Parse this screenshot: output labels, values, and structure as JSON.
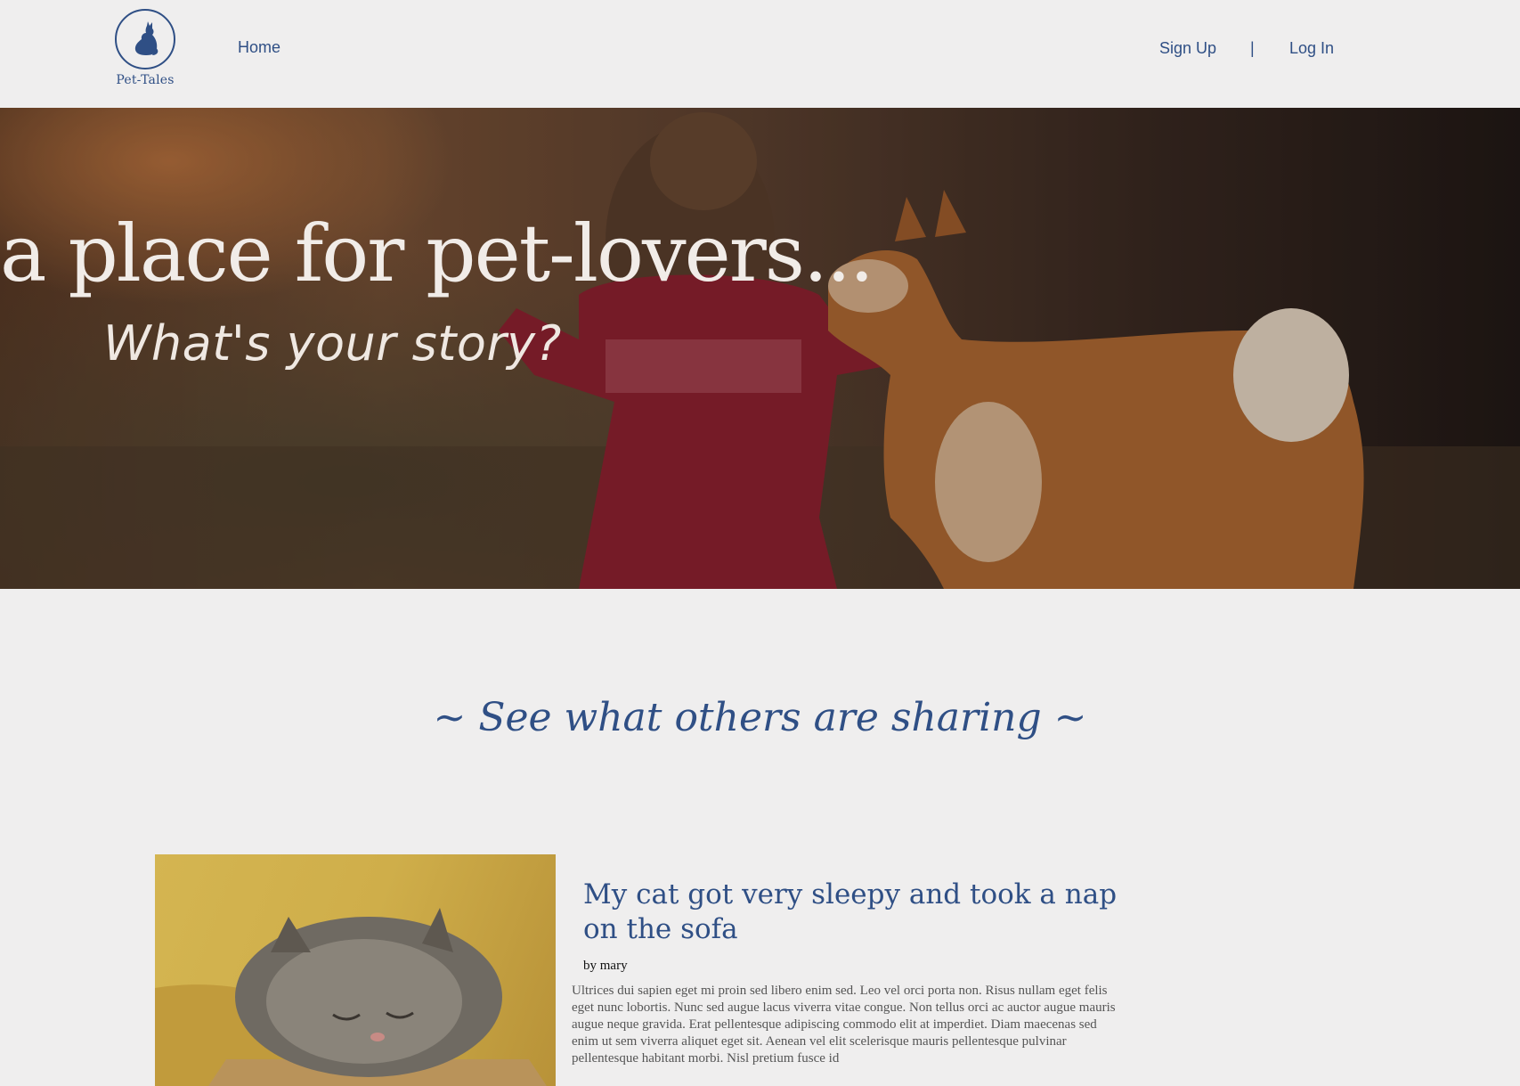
{
  "brand": {
    "name": "Pet-Tales",
    "icon": "cat-silhouette-icon"
  },
  "nav": {
    "home": "Home",
    "sign_up": "Sign Up",
    "separator": "|",
    "log_in": "Log In"
  },
  "hero": {
    "title": "a place for pet-lovers...",
    "subtitle": "What's your story?"
  },
  "section": {
    "title": "~ See what others are sharing ~"
  },
  "posts": [
    {
      "title": "My cat got very sleepy and took a nap on the sofa",
      "author": "by mary",
      "body": "Ultrices dui sapien eget mi proin sed libero enim sed. Leo vel orci porta non. Risus nullam eget felis eget nunc lobortis. Nunc sed augue lacus viverra vitae congue. Non tellus orci ac auctor augue mauris augue neque gravida. Erat pellentesque adipiscing commodo elit at imperdiet. Diam maecenas sed enim ut sem viverra aliquet eget sit. Aenean vel elit scelerisque mauris pellentesque pulvinar pellentesque habitant morbi. Nisl pretium fusce id"
    }
  ],
  "colors": {
    "accent": "#2f4f85",
    "background": "#efeeee"
  }
}
